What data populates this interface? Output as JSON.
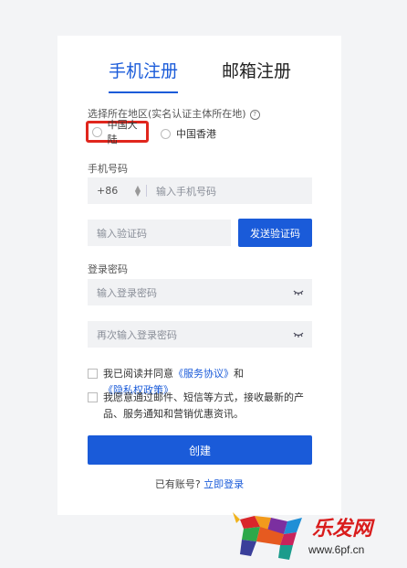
{
  "tabs": {
    "phone": "手机注册",
    "email": "邮箱注册"
  },
  "region": {
    "label": "选择所在地区(实名认证主体所在地)",
    "help_icon": "?",
    "options": [
      "中国大陆",
      "中国香港"
    ]
  },
  "phone": {
    "label": "手机号码",
    "country_code": "+86",
    "placeholder": "输入手机号码"
  },
  "verify": {
    "placeholder": "输入验证码",
    "send_label": "发送验证码"
  },
  "password": {
    "label": "登录密码",
    "placeholder": "输入登录密码",
    "confirm_placeholder": "再次输入登录密码"
  },
  "agreement": {
    "prefix": "我已阅读并同意",
    "service": "《服务协议》",
    "and": "和",
    "privacy": "《隐私权政策》"
  },
  "marketing": {
    "text": "我愿意通过邮件、短信等方式，接收最新的产品、服务通知和营销优惠资讯。"
  },
  "submit": {
    "label": "创建"
  },
  "login": {
    "prompt": "已有账号?",
    "link": "立即登录"
  },
  "watermark": {
    "brand": "乐发网",
    "url": "www.6pf.cn"
  },
  "colors": {
    "accent": "#1a5bd9",
    "highlight": "#e0261d"
  }
}
